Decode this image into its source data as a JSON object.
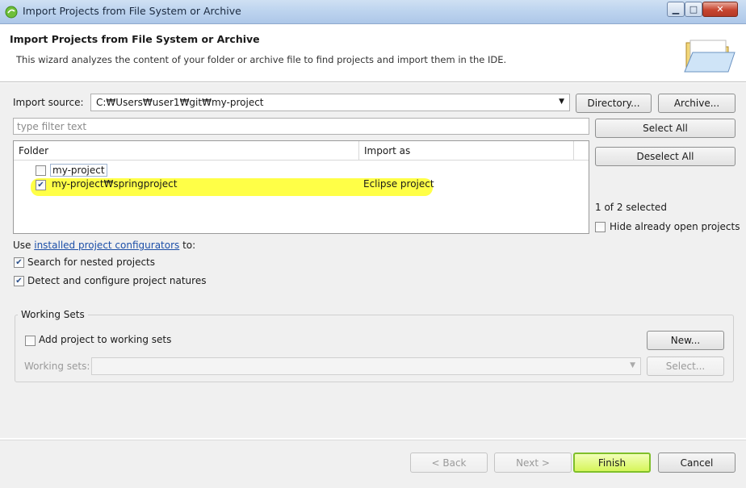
{
  "window": {
    "title": "Import Projects from File System or Archive"
  },
  "header": {
    "title": "Import Projects from File System or Archive",
    "description": "This wizard analyzes the content of your folder or archive file to find projects and import them in the IDE."
  },
  "import_source": {
    "label": "Import source:",
    "value": "C:\\Users\\user1\\git\\my-project",
    "value_display": "C:₩Users₩user1₩git₩my-project",
    "directory_button": "Directory...",
    "archive_button": "Archive..."
  },
  "filter": {
    "placeholder": "type filter text"
  },
  "table": {
    "columns": [
      "Folder",
      "Import as"
    ],
    "rows": [
      {
        "folder": "my-project",
        "import_as": "",
        "checked": false
      },
      {
        "folder": "my-project₩springproject",
        "import_as": "Eclipse project",
        "checked": true
      }
    ]
  },
  "side": {
    "select_all": "Select All",
    "deselect_all": "Deselect All",
    "selection_count": "1 of 2 selected",
    "hide_open_label": "Hide already open projects"
  },
  "options": {
    "use_prefix": "Use ",
    "configurators_link": "installed project configurators",
    "use_suffix": " to:",
    "nested_label": "Search for nested projects",
    "detect_label": "Detect and configure project natures"
  },
  "working_sets": {
    "group_title": "Working Sets",
    "add_label": "Add project to working sets",
    "new_button": "New...",
    "sets_label": "Working sets:",
    "select_button": "Select..."
  },
  "footer": {
    "back": "< Back",
    "next": "Next >",
    "finish": "Finish",
    "cancel": "Cancel"
  },
  "colors": {
    "highlight": "#ffff33",
    "link": "#1c4fa8",
    "finish_border": "#7fbf2a"
  }
}
